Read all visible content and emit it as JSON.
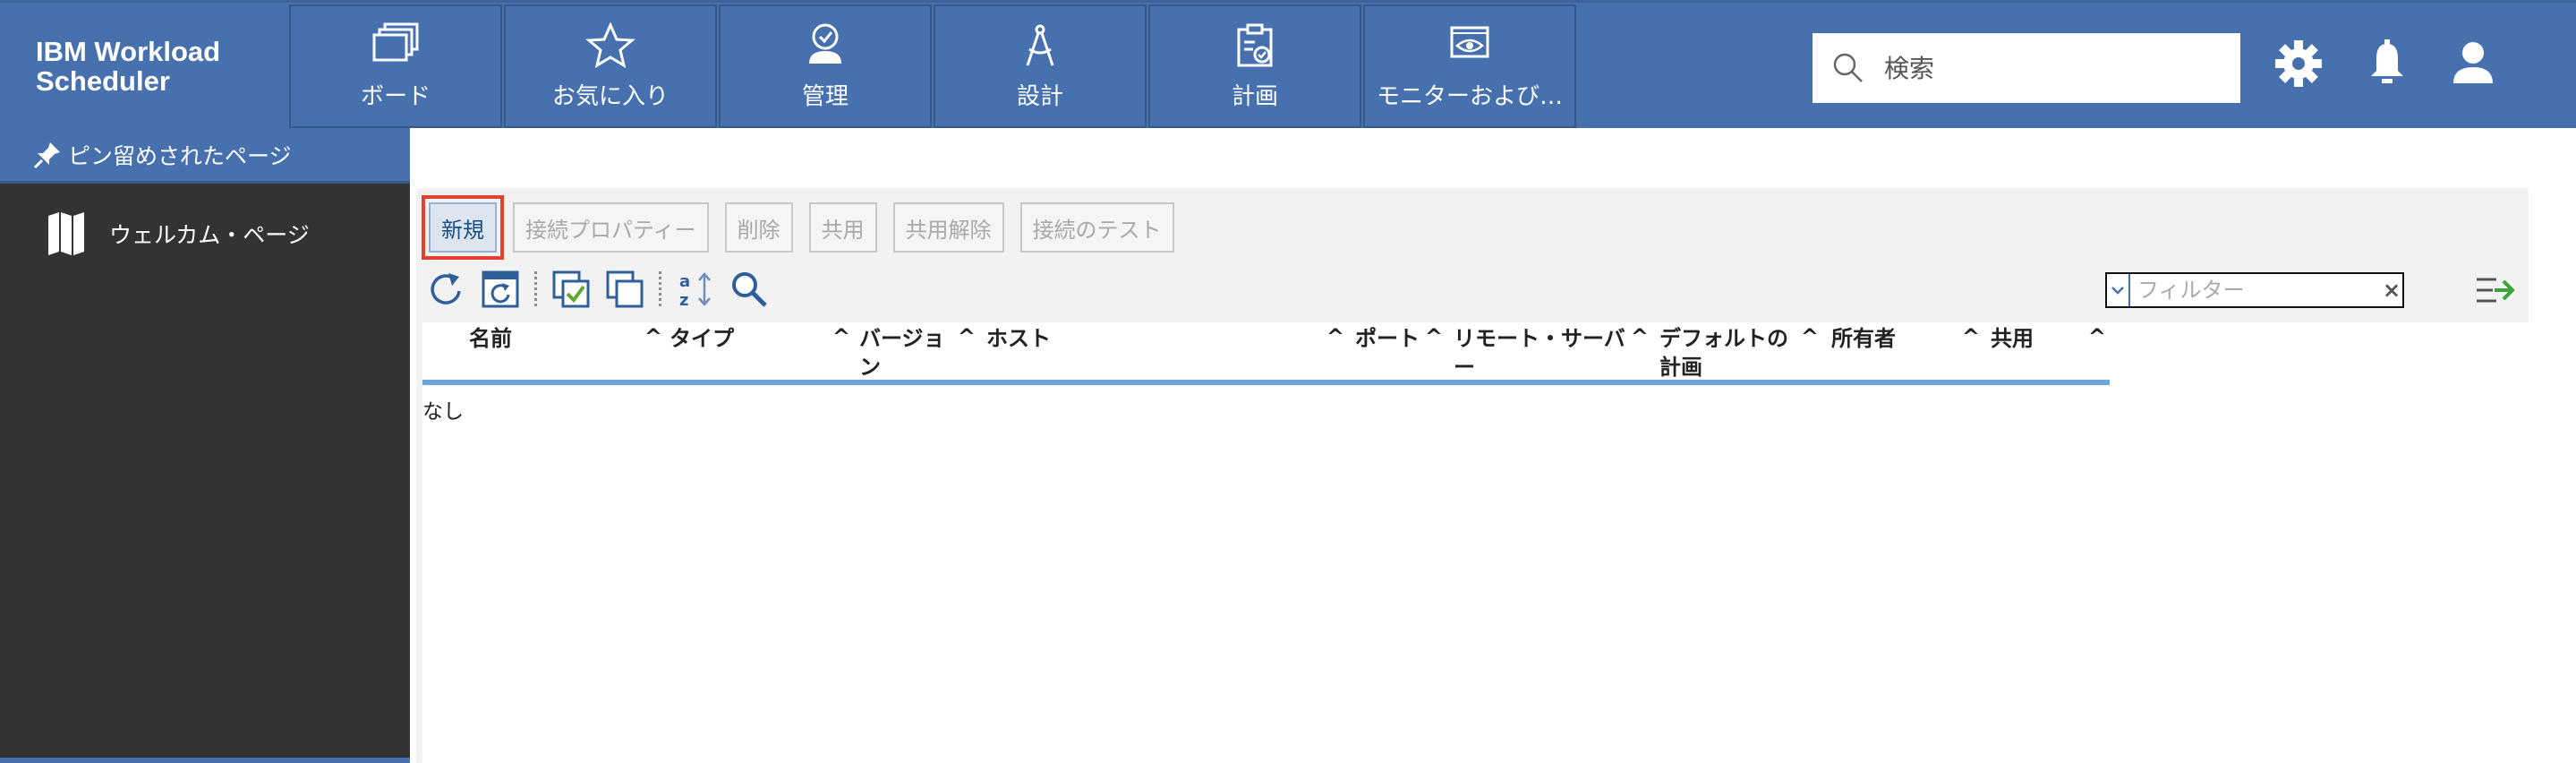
{
  "header": {
    "brand": "IBM Workload\nScheduler",
    "tabs": [
      {
        "label": "ボード",
        "icon": "boards-icon"
      },
      {
        "label": "お気に入り",
        "icon": "star-icon"
      },
      {
        "label": "管理",
        "icon": "admin-user-icon"
      },
      {
        "label": "設計",
        "icon": "compass-icon"
      },
      {
        "label": "計画",
        "icon": "clipboard-icon"
      },
      {
        "label": "モニターおよび…",
        "icon": "monitor-eye-icon"
      }
    ],
    "search_placeholder": "検索",
    "icons": [
      "gear-icon",
      "bell-icon",
      "user-icon"
    ]
  },
  "sidebar": {
    "pinned_label": "ピン留めされたページ",
    "items": [
      {
        "label": "ウェルカム・ページ",
        "icon": "map-icon"
      }
    ]
  },
  "toolbar": {
    "buttons": [
      {
        "label": "新規",
        "enabled": true
      },
      {
        "label": "接続プロパティー",
        "enabled": false
      },
      {
        "label": "削除",
        "enabled": false
      },
      {
        "label": "共用",
        "enabled": false
      },
      {
        "label": "共用解除",
        "enabled": false
      },
      {
        "label": "接続のテスト",
        "enabled": false
      }
    ],
    "icons": [
      "refresh-icon",
      "refresh-page-icon",
      "select-all-icon",
      "deselect-all-icon",
      "sort-az-icon",
      "search-icon"
    ],
    "filter_placeholder": "フィルター",
    "export_icon": "export-columns-icon"
  },
  "table": {
    "columns": [
      "名前",
      "タイプ",
      "バージョン",
      "ホスト",
      "ポート",
      "リモート・サーバー",
      "デフォルトの計画",
      "所有者",
      "共用"
    ],
    "empty_text": "なし"
  },
  "colors": {
    "header_bg": "#4670ae",
    "sidebar_bg": "#333333",
    "highlight": "#e2412c",
    "table_header_line": "#6ea4dc"
  }
}
